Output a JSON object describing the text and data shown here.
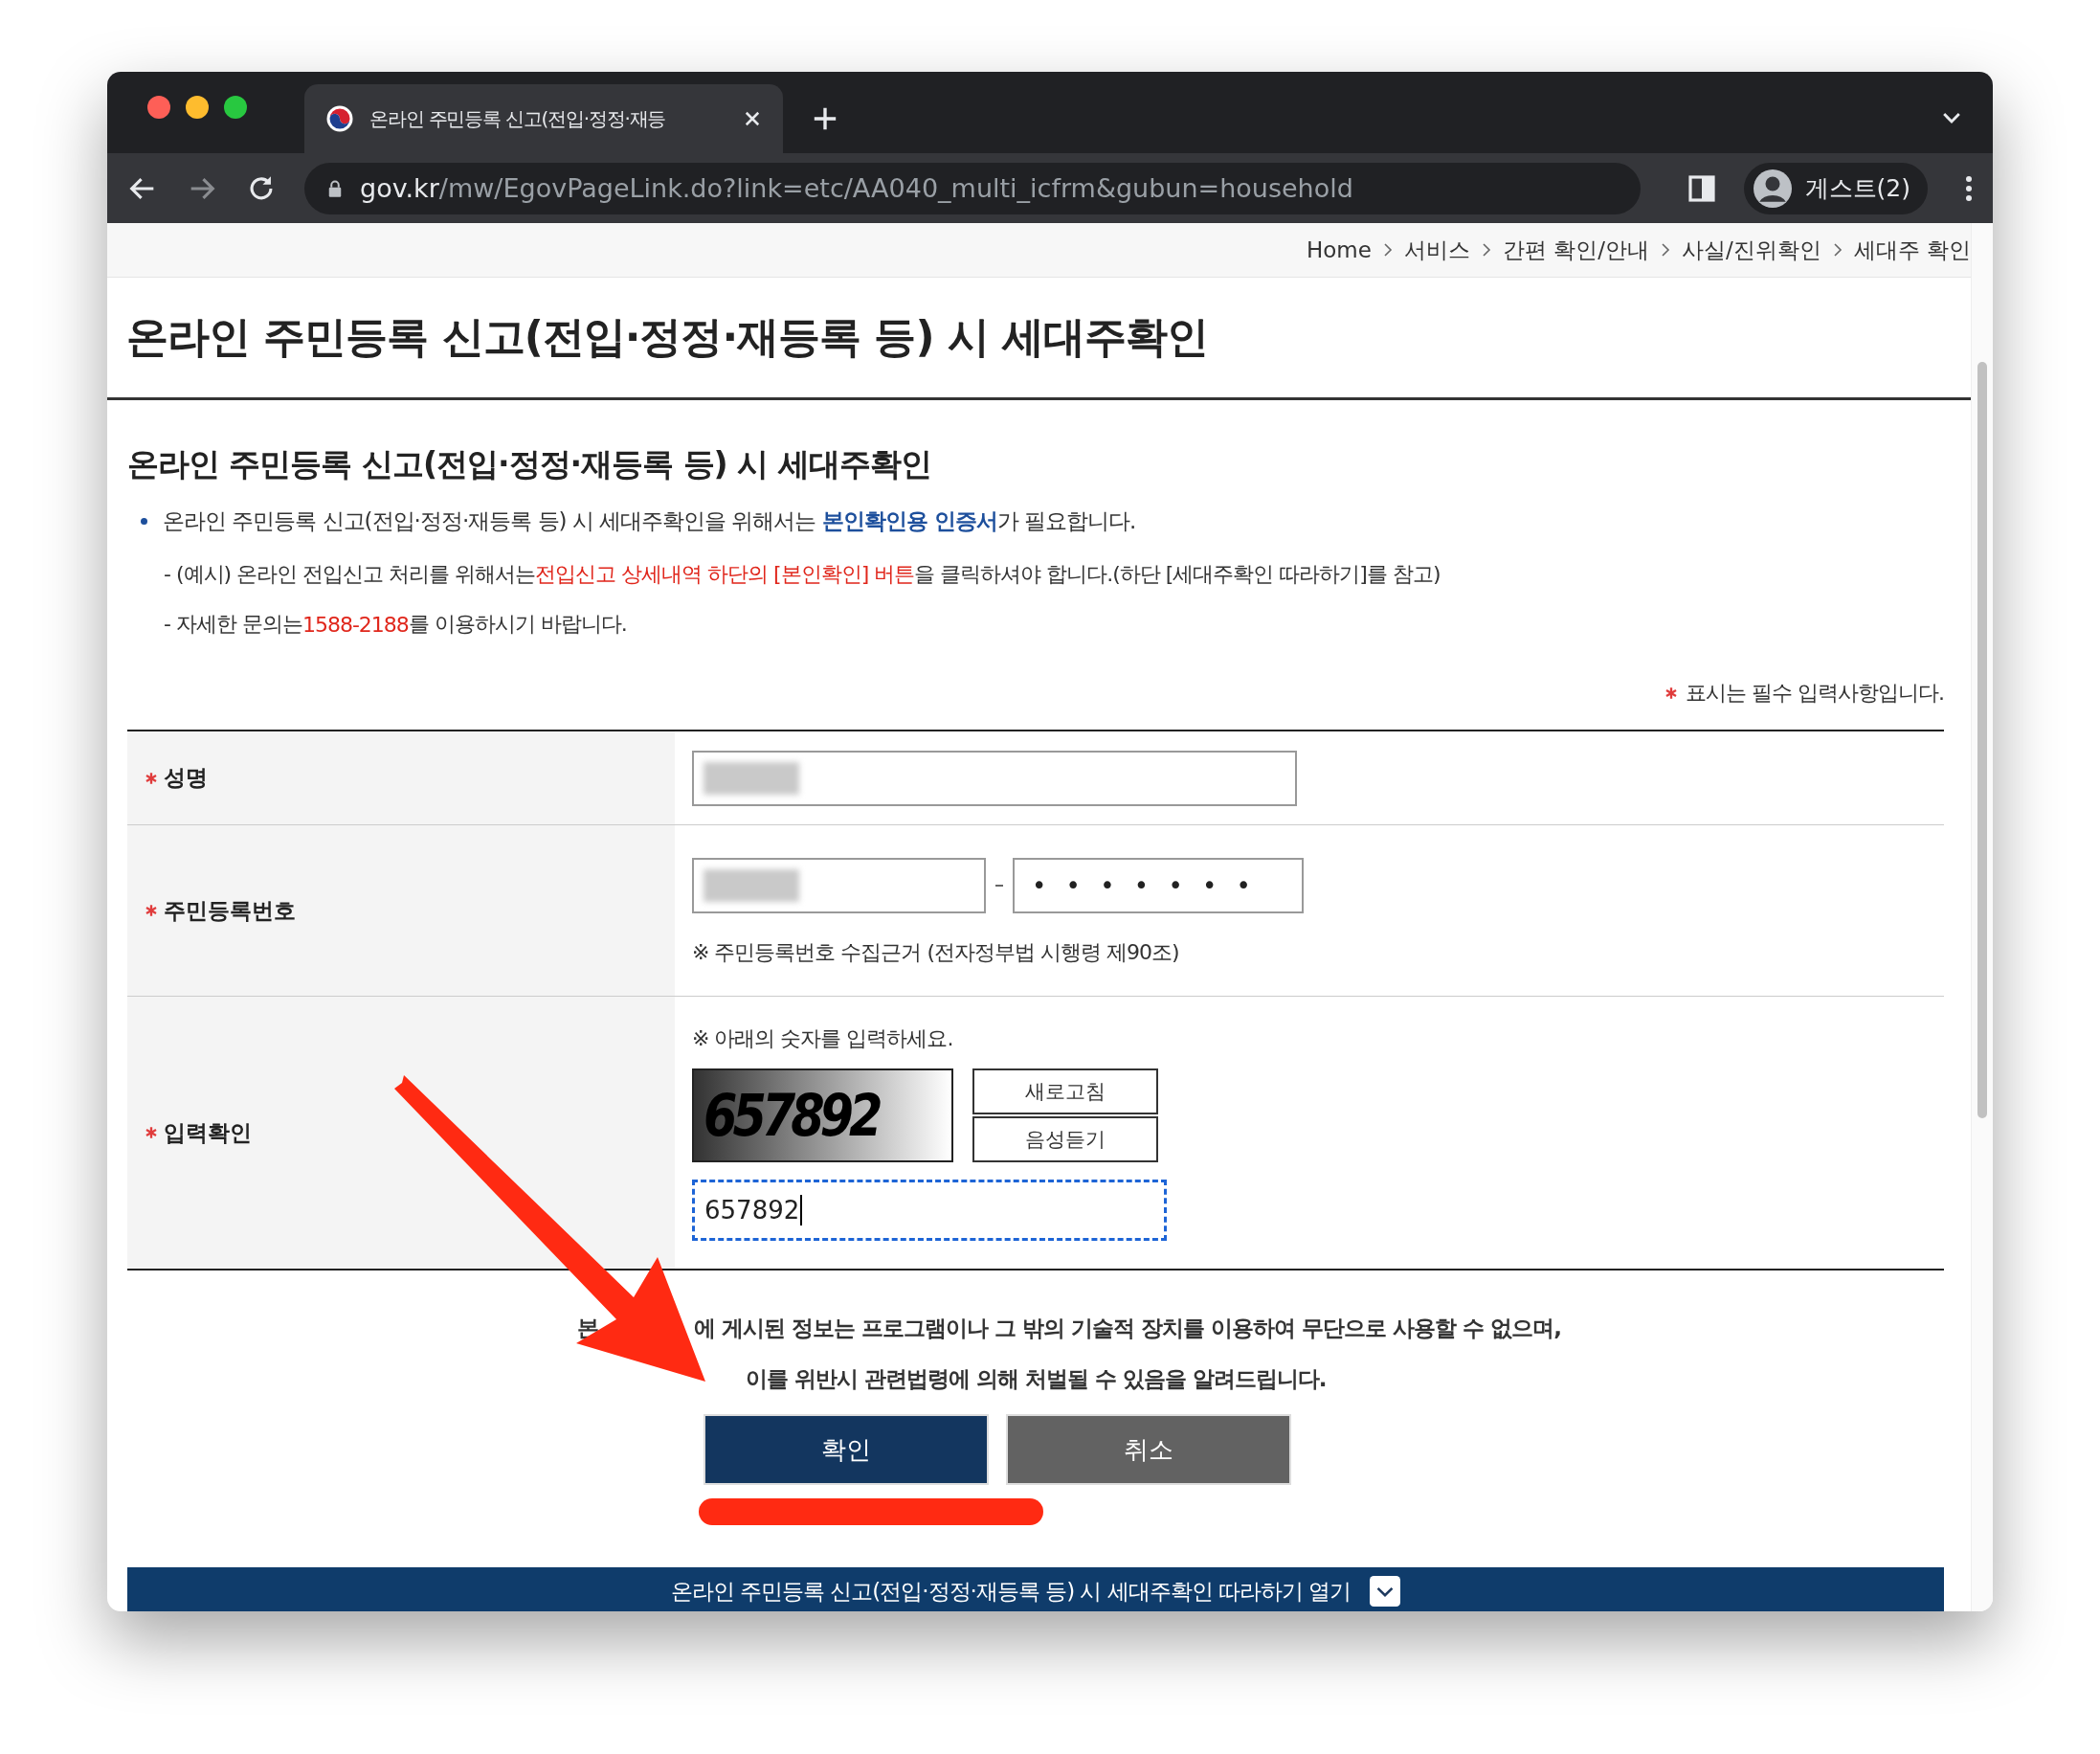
{
  "browser": {
    "tab_title": "온라인 주민등록 신고(전입·정정·재등",
    "url_host": "gov.kr",
    "url_path": "/mw/EgovPageLink.do?link=etc/AA040_multi_icfrm&gubun=household",
    "profile": "게스트(2)"
  },
  "breadcrumb": [
    "Home",
    "서비스",
    "간편 확인/안내",
    "사실/진위확인",
    "세대주 확인"
  ],
  "page_title": "온라인 주민등록 신고(전입·정정·재등록 등) 시 세대주확인",
  "section_title": "온라인 주민등록 신고(전입·정정·재등록 등) 시 세대주확인",
  "intro": "온라인 주민등록 신고(전입·정정·재등록 등) 시 세대주확인을 위해서는 **본인확인용 인증서**가 필요합니다.",
  "notes": [
    {
      "parts": [
        {
          "text": "- (예시) 온라인 전입신고 처리를 위해서는 ",
          "kind": "plain"
        },
        {
          "text": "전입신고 상세내역 하단의 [본인확인] 버튼",
          "kind": "red"
        },
        {
          "text": "을 클릭하셔야 합니다.(하단 [세대주확인 따라하기]를 참고)",
          "kind": "plain"
        }
      ]
    },
    {
      "parts": [
        {
          "text": "- 자세한 문의는 ",
          "kind": "plain"
        },
        {
          "text": "1588-2188",
          "kind": "red"
        },
        {
          "text": " 를 이용하시기 바랍니다.",
          "kind": "plain"
        }
      ]
    }
  ],
  "required_note": "표시는 필수 입력사항입니다.",
  "form": [
    {
      "label": "성명",
      "required": true,
      "kind": "name"
    },
    {
      "label": "주민등록번호",
      "required": true,
      "kind": "id",
      "second_value": "• • • • • • •",
      "hint": "※ 주민등록번호 수집근거 (전자정부법 시행령 제90조)"
    },
    {
      "label": "입력확인",
      "required": true,
      "kind": "captcha",
      "hint": "※ 아래의 숫자를 입력하세요.",
      "captcha": "657892",
      "buttons": [
        "새로고침",
        "음성듣기"
      ],
      "value": "657892",
      "focused": true
    }
  ],
  "notice": [
    [
      "본",
      "에 게시된 정보는 프로그램이나 그 밖의 기술적 장치를 이용하여 무단으로 사용할 수 없으며,"
    ],
    [
      "이를 위반시 관련법령에 의해 처벌될 수 있음을 알려드립니다."
    ]
  ],
  "actions": [
    {
      "label": "확인",
      "kind": "primary"
    },
    {
      "label": "취소",
      "kind": "secondary"
    }
  ],
  "guide_bar": "온라인 주민등록 신고(전입·정정·재등록 등) 시 세대주확인 따라하기 열기"
}
